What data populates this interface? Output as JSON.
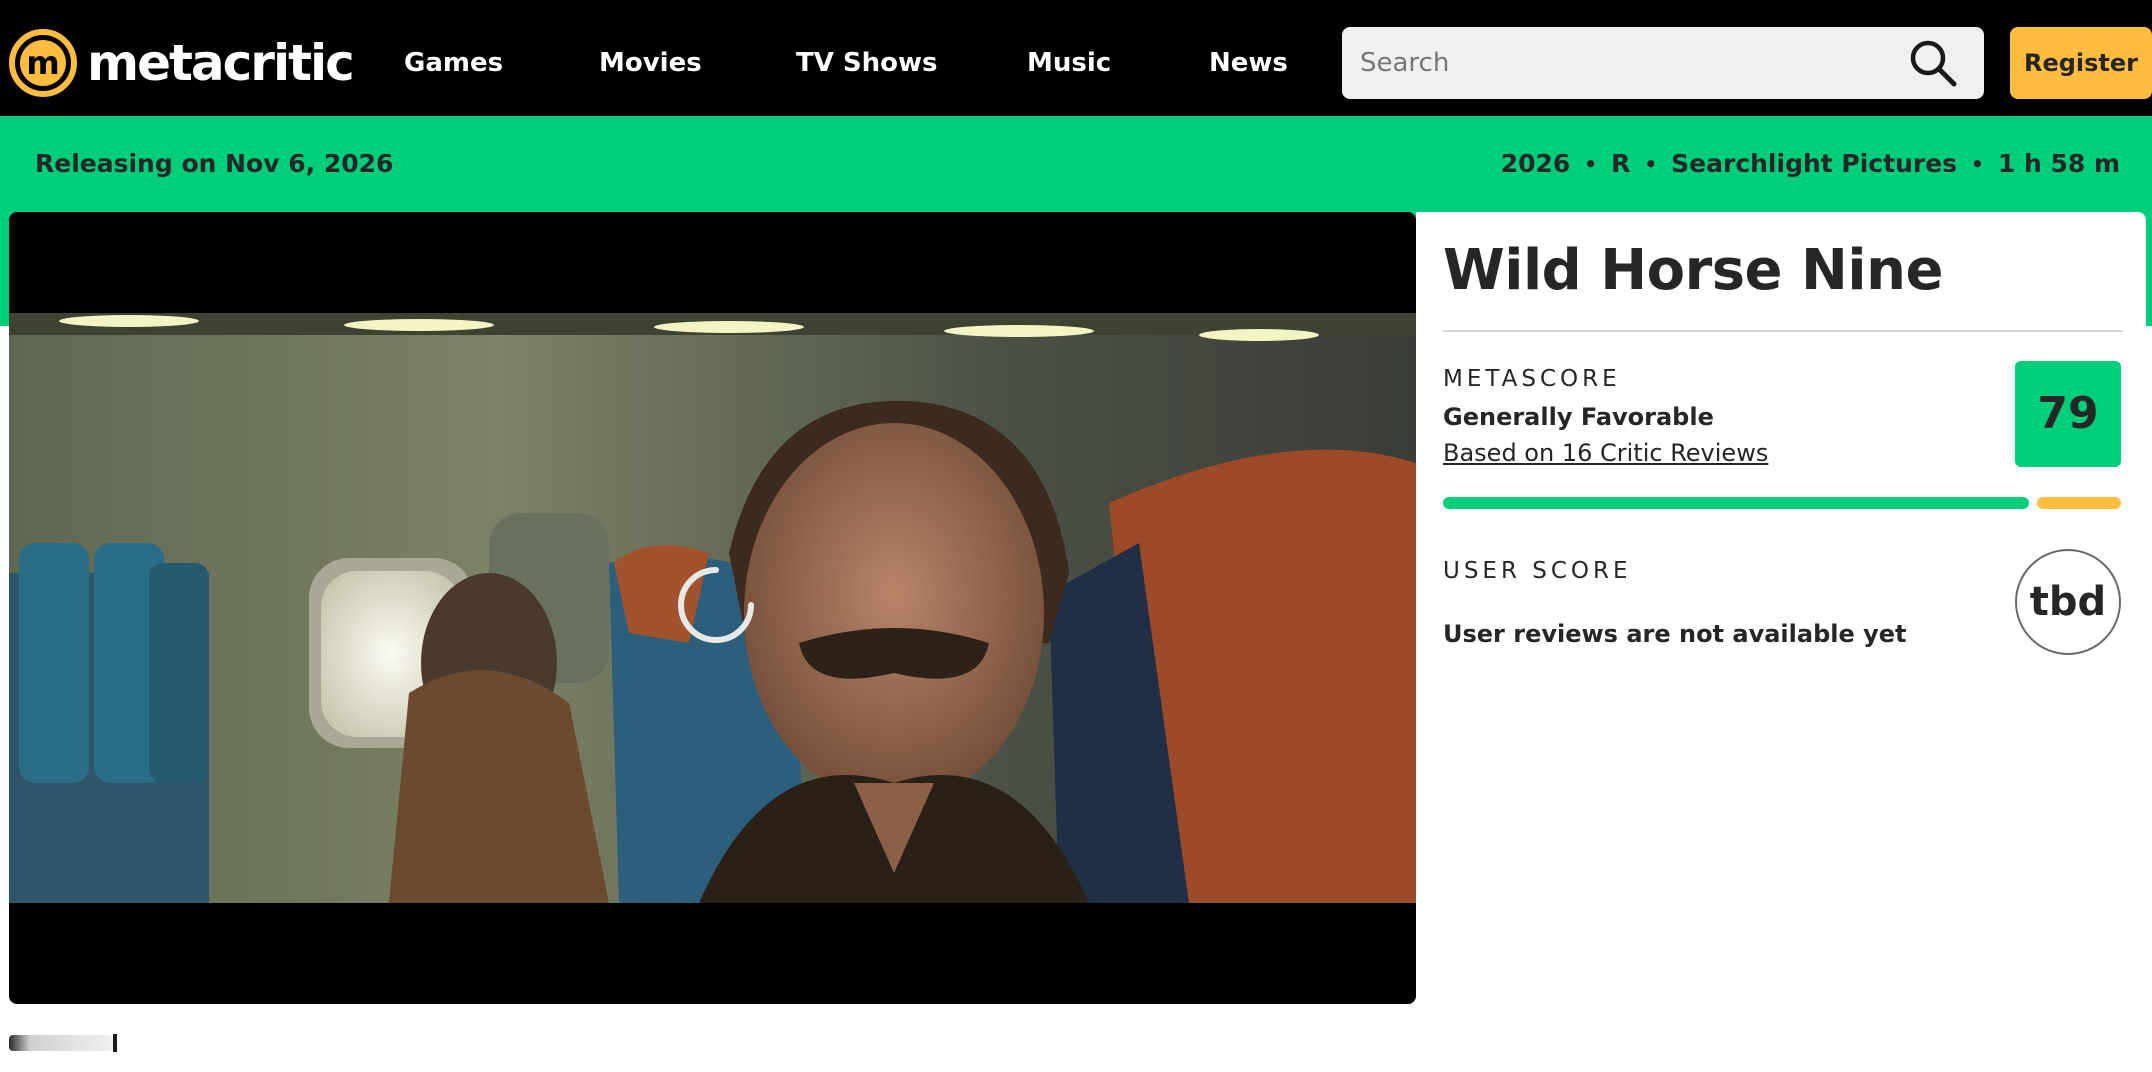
{
  "header": {
    "logo_text": "metacritic",
    "nav": [
      {
        "label": "Games"
      },
      {
        "label": "Movies"
      },
      {
        "label": "TV Shows"
      },
      {
        "label": "Music"
      },
      {
        "label": "News"
      }
    ],
    "search": {
      "placeholder": "Search",
      "value": ""
    },
    "register_label": "Register"
  },
  "release": {
    "label": "Releasing on Nov 6, 2026",
    "year": "2026",
    "rating": "R",
    "studio": "Searchlight Pictures",
    "runtime": "1 h 58 m",
    "separator": "•"
  },
  "product": {
    "title": "Wild Horse Nine",
    "metascore": {
      "label": "METASCORE",
      "value": "79",
      "sentiment": "Generally Favorable",
      "reviews_link": "Based on 16 Critic Reviews",
      "distribution": {
        "positive_fraction": 0.875,
        "mixed_fraction": 0.125
      }
    },
    "user_score": {
      "label": "USER SCORE",
      "value": "tbd",
      "message": "User reviews are not available yet"
    }
  },
  "colors": {
    "brand_green": "#00ce7a",
    "brand_yellow": "#ffbd3f",
    "header_bg": "#000000",
    "text": "#262626"
  },
  "icons": {
    "logo": "metacritic-logo-icon",
    "search": "search-icon",
    "loading": "loading-spinner-icon"
  }
}
